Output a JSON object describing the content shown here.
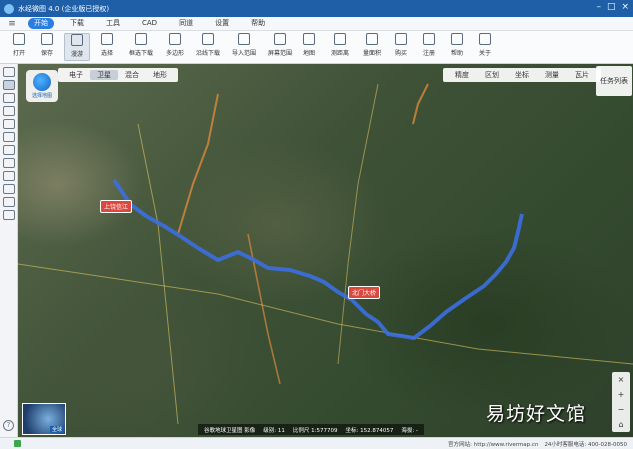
{
  "app": {
    "title": "水经微图 4.0 (企业版已授权)"
  },
  "menu": {
    "items": [
      "开始",
      "下载",
      "工具",
      "CAD",
      "同道",
      "设置",
      "帮助"
    ]
  },
  "toolbar": {
    "open_label": "打开",
    "items": [
      "保存",
      "漫游",
      "选择",
      "框选下载",
      "多边形",
      "沿线下载",
      "导入范围",
      "屏幕范围",
      "地图",
      "测距离",
      "量面积",
      "购买",
      "注册",
      "帮助",
      "关于"
    ]
  },
  "map": {
    "types": [
      "电子",
      "卫星",
      "混合",
      "地形"
    ],
    "active_type": "卫星",
    "right_tools": [
      "精度",
      "区划",
      "坐标",
      "测量",
      "瓦片"
    ],
    "task_button": "任务列表",
    "badge_label": "选择地图",
    "minimap_label": "全球",
    "zoom_controls": [
      "+",
      "−"
    ],
    "route_labels": [
      "上饶信江",
      "北门大桥"
    ]
  },
  "info_bar": {
    "source": "谷歌地球卫星图 影像",
    "level": "级别: 11",
    "scale": "比例尺 1:577709",
    "coords": "坐标: 152.874057",
    "elev": "海拔: -"
  },
  "statusbar": {
    "website_label": "官方网站: http://www.rivermap.cn",
    "hotline": "24小时客服电话: 400-028-0050"
  },
  "watermark": "易坊好文馆",
  "colors": {
    "accent": "#2a7de1",
    "titlebar": "#1e5fa8",
    "route": "#3b6fe0"
  }
}
